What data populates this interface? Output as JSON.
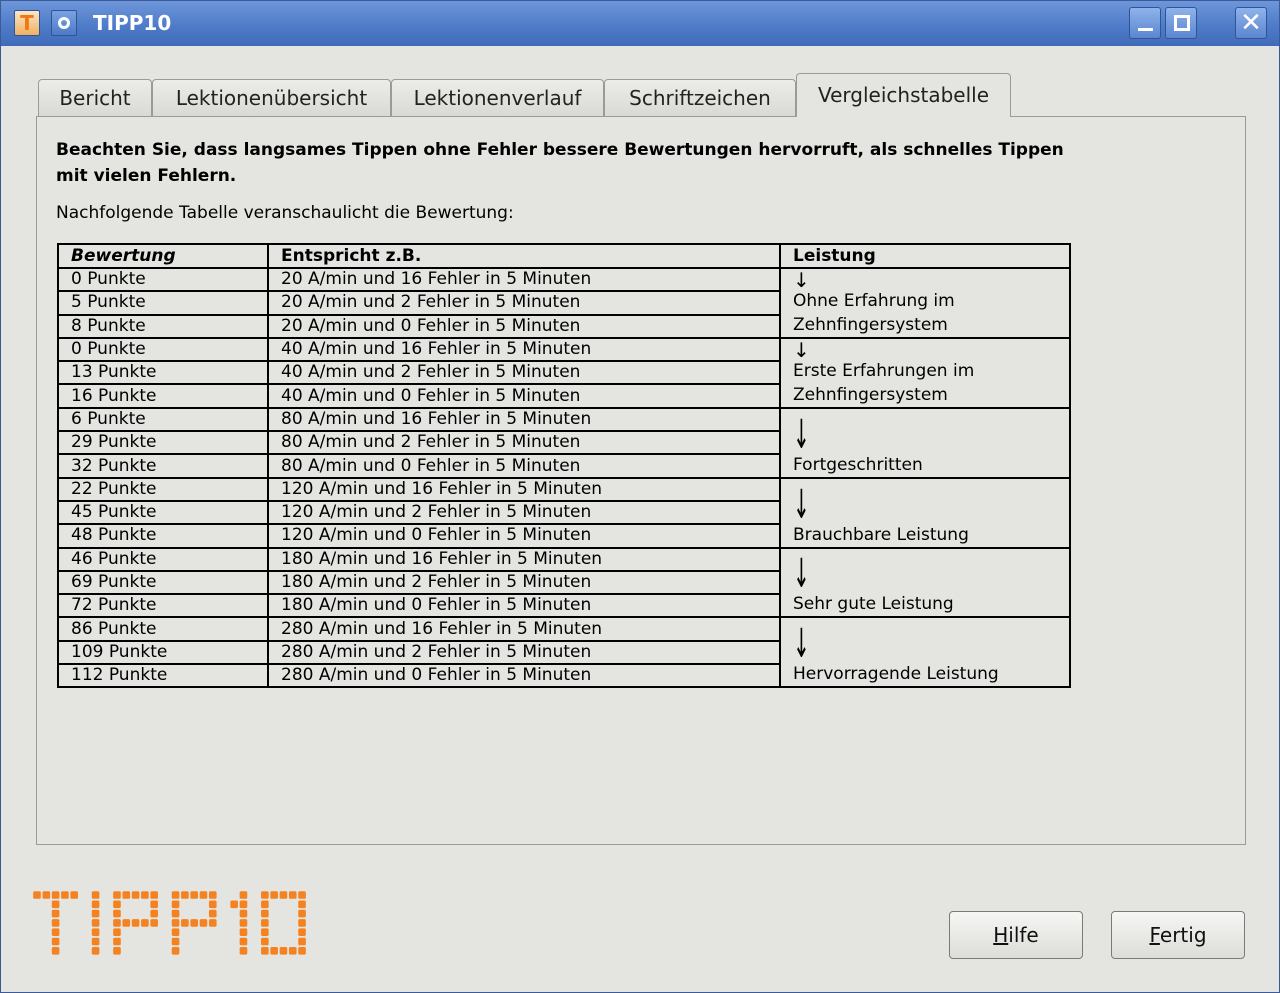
{
  "window": {
    "title": "TIPP10"
  },
  "tabs": [
    {
      "label": "Bericht"
    },
    {
      "label": "Lektionenübersicht"
    },
    {
      "label": "Lektionenverlauf"
    },
    {
      "label": "Schriftzeichen"
    },
    {
      "label": "Vergleichstabelle"
    }
  ],
  "active_tab": "Vergleichstabelle",
  "content": {
    "note": "Beachten Sie, dass langsames Tippen ohne Fehler bessere Bewertungen hervorruft, als schnelles Tippen mit vielen Fehlern.",
    "intro": "Nachfolgende Tabelle veranschaulicht die Bewertung:"
  },
  "table": {
    "headers": [
      "Bewertung",
      "Entspricht z.B.",
      "Leistung"
    ],
    "groups": [
      {
        "performance": "Ohne Erfahrung im Zehnfingersystem",
        "rows": [
          [
            "0 Punkte",
            "20 A/min und 16 Fehler in 5 Minuten"
          ],
          [
            "5 Punkte",
            "20 A/min und 2 Fehler in 5 Minuten"
          ],
          [
            "8 Punkte",
            "20 A/min und 0 Fehler in 5 Minuten"
          ]
        ]
      },
      {
        "performance": "Erste Erfahrungen im Zehnfingersystem",
        "rows": [
          [
            "0 Punkte",
            "40 A/min und 16 Fehler in 5 Minuten"
          ],
          [
            "13 Punkte",
            "40 A/min und 2 Fehler in 5 Minuten"
          ],
          [
            "16 Punkte",
            "40 A/min und 0 Fehler in 5 Minuten"
          ]
        ]
      },
      {
        "performance": "Fortgeschritten",
        "rows": [
          [
            "6 Punkte",
            "80 A/min und 16 Fehler in 5 Minuten"
          ],
          [
            "29 Punkte",
            "80 A/min und 2 Fehler in 5 Minuten"
          ],
          [
            "32 Punkte",
            "80 A/min und 0 Fehler in 5 Minuten"
          ]
        ]
      },
      {
        "performance": "Brauchbare Leistung",
        "rows": [
          [
            "22 Punkte",
            "120 A/min und 16 Fehler in 5 Minuten"
          ],
          [
            "45 Punkte",
            "120 A/min und 2 Fehler in 5 Minuten"
          ],
          [
            "48 Punkte",
            "120 A/min und 0 Fehler in 5 Minuten"
          ]
        ]
      },
      {
        "performance": "Sehr gute Leistung",
        "rows": [
          [
            "46 Punkte",
            "180 A/min und 16 Fehler in 5 Minuten"
          ],
          [
            "69 Punkte",
            "180 A/min und 2 Fehler in 5 Minuten"
          ],
          [
            "72 Punkte",
            "180 A/min und 0 Fehler in 5 Minuten"
          ]
        ]
      },
      {
        "performance": "Hervorragende Leistung",
        "rows": [
          [
            "86 Punkte",
            "280 A/min und 16 Fehler in 5 Minuten"
          ],
          [
            "109 Punkte",
            "280 A/min und 2 Fehler in 5 Minuten"
          ],
          [
            "112 Punkte",
            "280 A/min und 0 Fehler in 5 Minuten"
          ]
        ]
      }
    ]
  },
  "logo": {
    "text": "TIPP10",
    "color": "#f58220"
  },
  "buttons": {
    "help": "Hilfe",
    "done": "Fertig"
  },
  "icons": {
    "app": "tipp10-app-icon",
    "menu": "window-menu-icon"
  }
}
